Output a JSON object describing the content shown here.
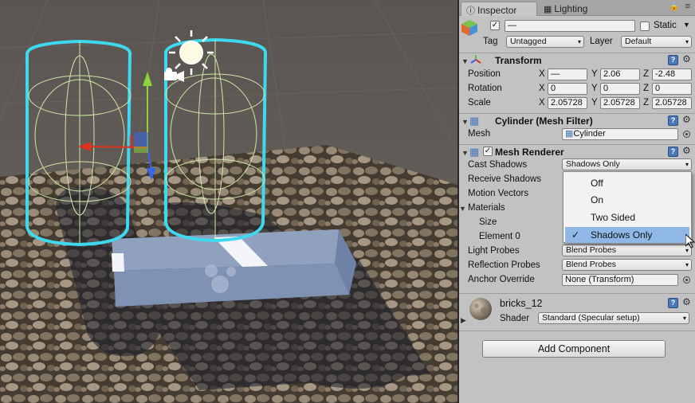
{
  "tabs": {
    "inspector_label": "Inspector",
    "lighting_label": "Lighting"
  },
  "object": {
    "name_value": "—",
    "static_label": "Static",
    "tag_label": "Tag",
    "tag_value": "Untagged",
    "layer_label": "Layer",
    "layer_value": "Default"
  },
  "transform": {
    "title": "Transform",
    "position_label": "Position",
    "rotation_label": "Rotation",
    "scale_label": "Scale",
    "position": {
      "x": "—",
      "y": "2.06",
      "z": "-2.48"
    },
    "rotation": {
      "x": "0",
      "y": "0",
      "z": "0"
    },
    "scale": {
      "x": "2.05728",
      "y": "2.05728",
      "z": "2.05728"
    }
  },
  "mesh_filter": {
    "title": "Cylinder (Mesh Filter)",
    "mesh_label": "Mesh",
    "mesh_value": "Cylinder"
  },
  "mesh_renderer": {
    "title": "Mesh Renderer",
    "cast_shadows_label": "Cast Shadows",
    "cast_shadows_value": "Shadows Only",
    "receive_shadows_label": "Receive Shadows",
    "motion_vectors_label": "Motion Vectors",
    "materials_label": "Materials",
    "size_label": "Size",
    "element0_label": "Element 0",
    "light_probes_label": "Light Probes",
    "light_probes_value": "Blend Probes",
    "reflection_probes_label": "Reflection Probes",
    "reflection_probes_value": "Blend Probes",
    "anchor_override_label": "Anchor Override",
    "anchor_override_value": "None (Transform)"
  },
  "cast_shadows_menu": {
    "options": [
      "Off",
      "On",
      "Two Sided",
      "Shadows Only"
    ],
    "selected": "Shadows Only"
  },
  "material": {
    "name": "bricks_12",
    "shader_label": "Shader",
    "shader_value": "Standard (Specular setup)"
  },
  "add_component_label": "Add Component",
  "axis_labels": {
    "x": "X",
    "y": "Y",
    "z": "Z"
  },
  "colors": {
    "selection_outline": "#3fd9ef",
    "menu_highlight": "#8fb8e8",
    "gizmo_x": "#e0301e",
    "gizmo_y": "#8dd33a",
    "gizmo_z": "#3567e8"
  }
}
